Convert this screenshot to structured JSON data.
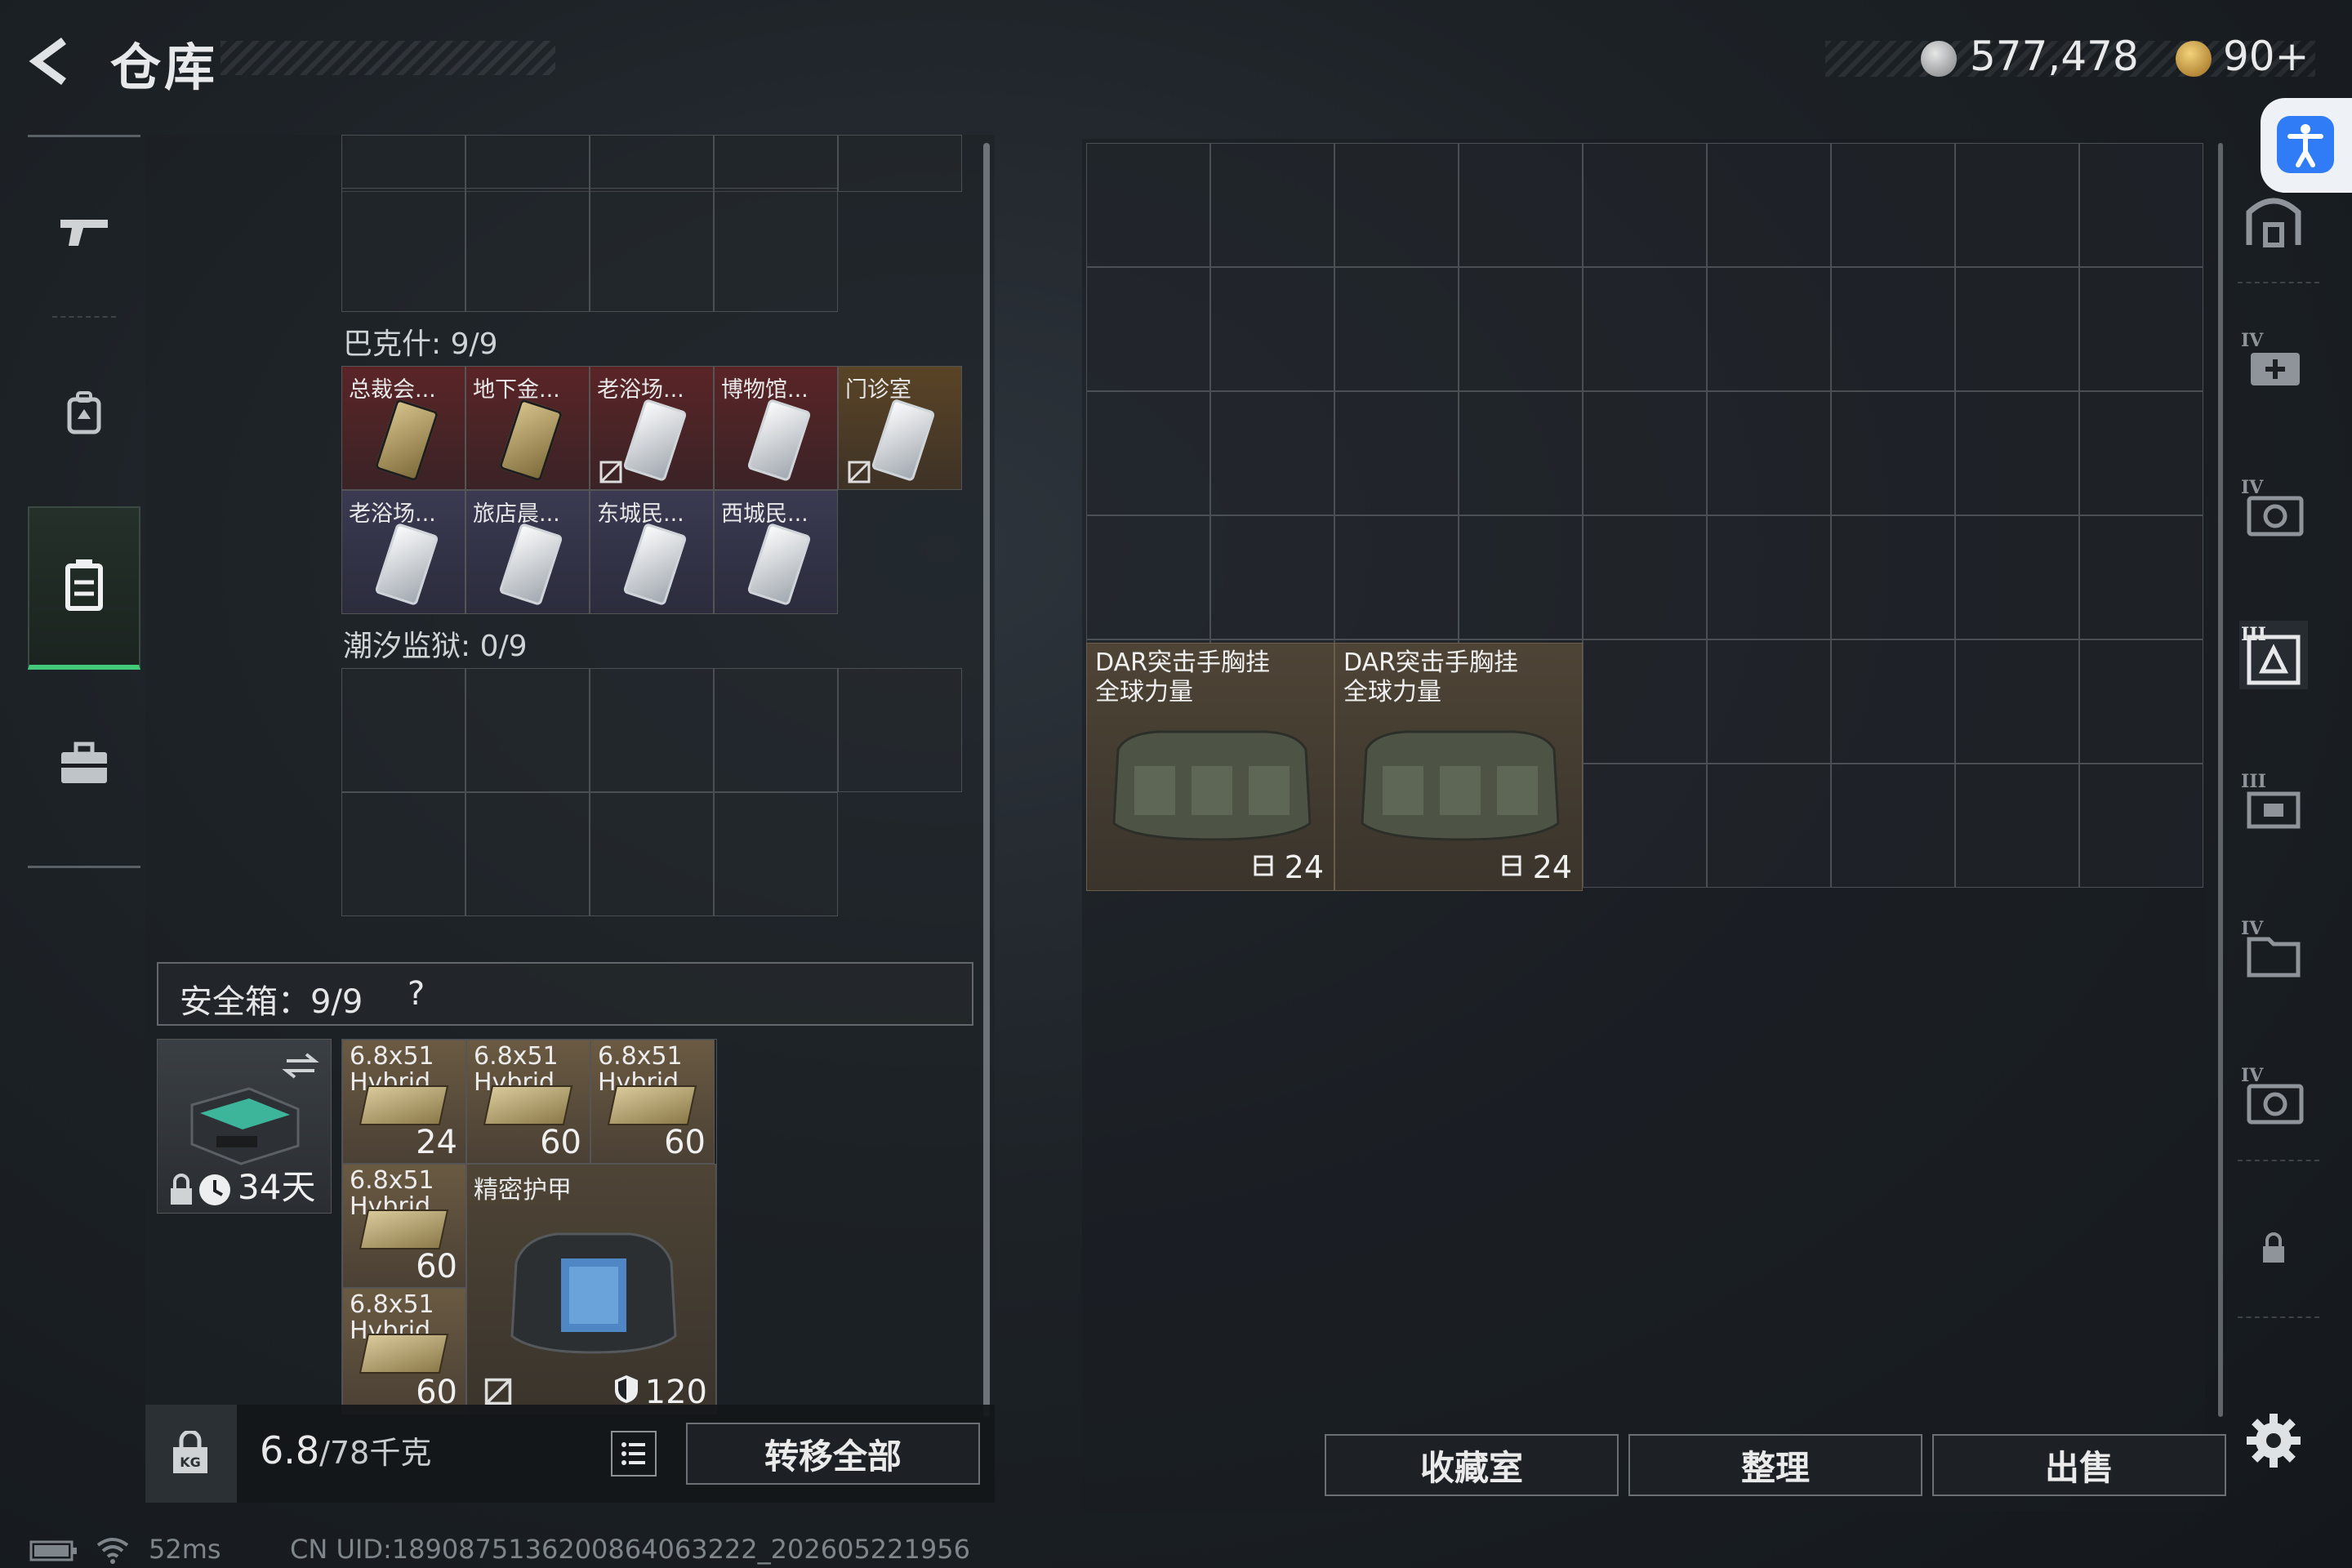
{
  "header": {
    "title": "仓库",
    "currency_1": "577,478",
    "currency_2": "90+"
  },
  "left_stash": {
    "sections": [
      {
        "label": "巴克什: 9/9",
        "items": [
          {
            "name": "总裁会...",
            "card": "gold",
            "bg": "red",
            "nosell": false
          },
          {
            "name": "地下金...",
            "card": "gold",
            "bg": "red",
            "nosell": false
          },
          {
            "name": "老浴场...",
            "card": "silver",
            "bg": "red",
            "nosell": true
          },
          {
            "name": "博物馆...",
            "card": "silver",
            "bg": "red",
            "nosell": false
          },
          {
            "name": "门诊室",
            "card": "silver",
            "bg": "gold",
            "nosell": true
          },
          {
            "name": "老浴场...",
            "card": "silver",
            "bg": "purple",
            "nosell": false
          },
          {
            "name": "旅店晨...",
            "card": "silver",
            "bg": "purple",
            "nosell": false
          },
          {
            "name": "东城民...",
            "card": "silver",
            "bg": "purple",
            "nosell": false
          },
          {
            "name": "西城民...",
            "card": "silver",
            "bg": "purple",
            "nosell": false
          }
        ]
      },
      {
        "label": "潮汐监狱: 0/9",
        "items": []
      }
    ]
  },
  "safe_box": {
    "label": "安全箱：9/9",
    "help": "?",
    "duration": "34天",
    "items": [
      {
        "name": "6.8x51\nHybrid",
        "count": "24"
      },
      {
        "name": "6.8x51\nHybrid",
        "count": "60"
      },
      {
        "name": "6.8x51\nHybrid",
        "count": "60"
      },
      {
        "name": "6.8x51\nHybrid",
        "count": "60"
      },
      {
        "name": "6.8x51\nHybrid",
        "count": "60"
      }
    ],
    "armor": {
      "name": "精密护甲",
      "value": "120"
    }
  },
  "bottom_left": {
    "weight_current": "6.8",
    "weight_total": "/78千克",
    "transfer_all": "转移全部"
  },
  "right_storage": {
    "items": [
      {
        "name": "DAR突击手胸挂\n全球力量",
        "count": "24"
      },
      {
        "name": "DAR突击手胸挂\n全球力量",
        "count": "24"
      }
    ],
    "buttons": {
      "collection": "收藏室",
      "organize": "整理",
      "sell": "出售"
    }
  },
  "right_rail": {
    "icons": [
      "home-icon",
      "medical-case-icon",
      "camera-case-icon",
      "active-box-icon",
      "box-tier3-icon",
      "file-box-icon",
      "camera-box-icon",
      "lock-icon"
    ],
    "tiers": [
      "IV",
      "IV",
      "III",
      "III",
      "IV",
      "IV"
    ]
  },
  "status": {
    "ping": "52ms",
    "uid": "CN UID:1890875136200864063222_202605221956"
  },
  "colors": {
    "accent_green": "#43c97a",
    "a11y_blue": "#2f7cf6",
    "key_red": "#5a2427",
    "key_purple": "#3a3a52"
  }
}
